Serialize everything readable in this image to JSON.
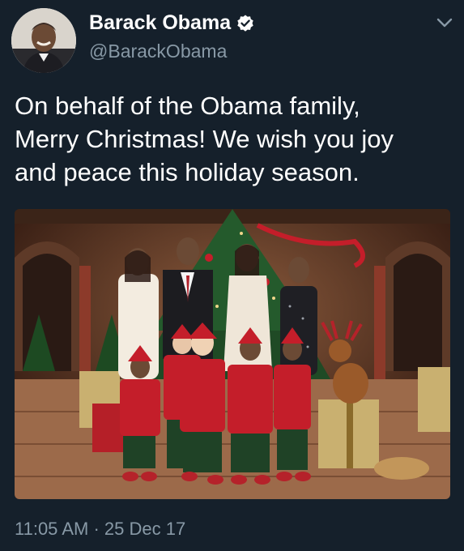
{
  "author": {
    "display_name": "Barack Obama",
    "handle": "@BarackObama",
    "verified_icon": "verified-badge-icon"
  },
  "tweet": {
    "text": "On behalf of the Obama family,\nMerry Christmas! We wish you joy\nand peace this holiday season."
  },
  "timestamp": {
    "time": "11:05 AM",
    "separator": "·",
    "date": "25 Dec 17"
  },
  "colors": {
    "background": "#15202b",
    "secondary_text": "#8899a6",
    "verified_blue": "#ffffff",
    "elf_red": "#c41e2a"
  },
  "icons": [
    "avatar-image",
    "verified-badge-icon",
    "chevron-down-icon"
  ]
}
